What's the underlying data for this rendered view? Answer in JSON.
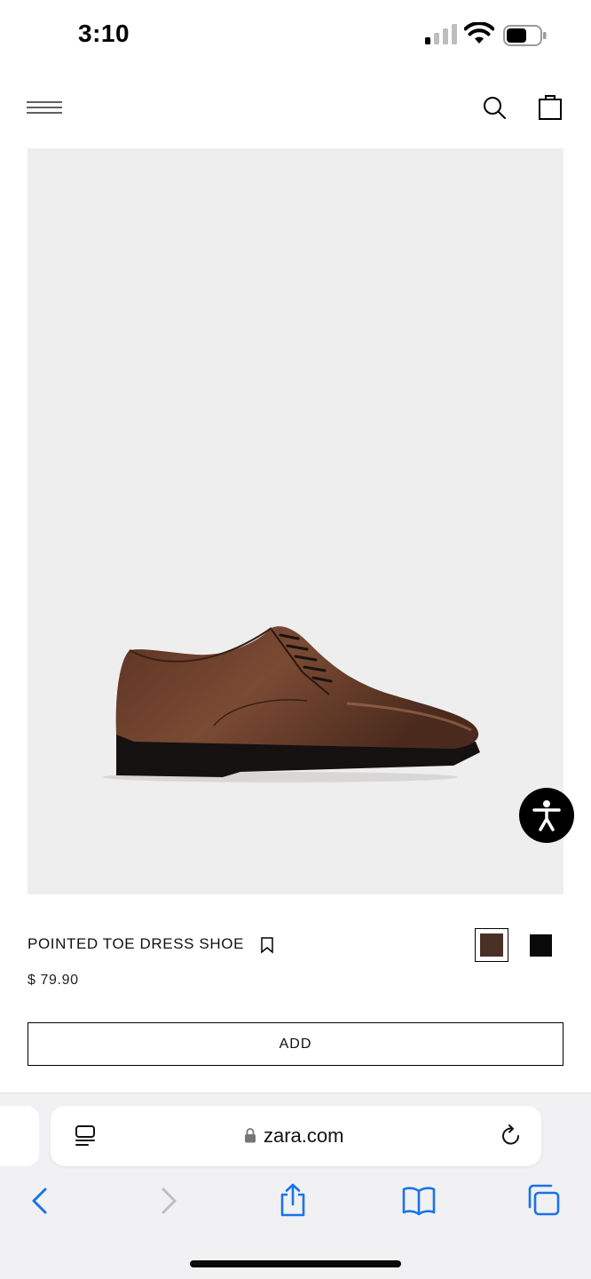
{
  "status_bar": {
    "time": "3:10"
  },
  "header": {
    "menu_icon": "hamburger-menu-icon",
    "search_icon": "search-icon",
    "bag_icon": "shopping-bag-icon"
  },
  "product": {
    "image_icon": "dress-shoe-image",
    "name": "POINTED TOE DRESS SHOE",
    "price": "$ 79.90",
    "add_label": "ADD",
    "colors": [
      {
        "swatch": "#4a2f25",
        "selected": true
      },
      {
        "swatch": "#0a0a0a",
        "selected": false
      }
    ]
  },
  "browser": {
    "url": "zara.com",
    "toolbar_icons": [
      "back-icon",
      "forward-icon",
      "share-icon",
      "bookmarks-icon",
      "tabs-icon"
    ]
  },
  "colors": {
    "image_bg": "#efeeee",
    "accent": "#000000",
    "link_blue": "#1a73e8"
  }
}
